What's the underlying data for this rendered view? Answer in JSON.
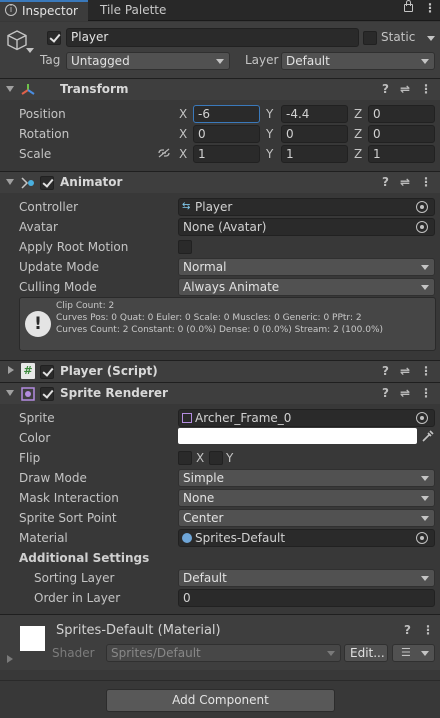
{
  "tabs": [
    {
      "label": "Inspector"
    },
    {
      "label": "Tile Palette"
    }
  ],
  "object": {
    "name": "Player",
    "static_label": "Static",
    "tag_label": "Tag",
    "tag_value": "Untagged",
    "layer_label": "Layer",
    "layer_value": "Default"
  },
  "transform": {
    "title": "Transform",
    "position_label": "Position",
    "rotation_label": "Rotation",
    "scale_label": "Scale",
    "x": "X",
    "y": "Y",
    "z": "Z",
    "position": {
      "x": "-6",
      "y": "-4.4",
      "z": "0"
    },
    "rotation": {
      "x": "0",
      "y": "0",
      "z": "0"
    },
    "scale": {
      "x": "1",
      "y": "1",
      "z": "1"
    }
  },
  "animator": {
    "title": "Animator",
    "controller_label": "Controller",
    "controller_value": "Player",
    "avatar_label": "Avatar",
    "avatar_value": "None (Avatar)",
    "apply_root_motion_label": "Apply Root Motion",
    "update_mode_label": "Update Mode",
    "update_mode_value": "Normal",
    "culling_mode_label": "Culling Mode",
    "culling_mode_value": "Always Animate",
    "info_line1": "Clip Count: 2",
    "info_line2": "Curves Pos: 0 Quat: 0 Euler: 0 Scale: 0 Muscles: 0 Generic: 0 PPtr: 2",
    "info_line3": "Curves Count: 2 Constant: 0 (0.0%) Dense: 0 (0.0%) Stream: 2 (100.0%)"
  },
  "player_script": {
    "title": "Player (Script)"
  },
  "sprite_renderer": {
    "title": "Sprite Renderer",
    "sprite_label": "Sprite",
    "sprite_value": "Archer_Frame_0",
    "color_label": "Color",
    "color_value": "#ffffff",
    "flip_label": "Flip",
    "flip_x": "X",
    "flip_y": "Y",
    "draw_mode_label": "Draw Mode",
    "draw_mode_value": "Simple",
    "mask_label": "Mask Interaction",
    "mask_value": "None",
    "sort_point_label": "Sprite Sort Point",
    "sort_point_value": "Center",
    "material_label": "Material",
    "material_value": "Sprites-Default",
    "additional_label": "Additional Settings",
    "sorting_layer_label": "Sorting Layer",
    "sorting_layer_value": "Default",
    "order_label": "Order in Layer",
    "order_value": "0"
  },
  "material": {
    "title": "Sprites-Default (Material)",
    "shader_label": "Shader",
    "shader_value": "Sprites/Default",
    "edit_label": "Edit..."
  },
  "add_component_label": "Add Component"
}
